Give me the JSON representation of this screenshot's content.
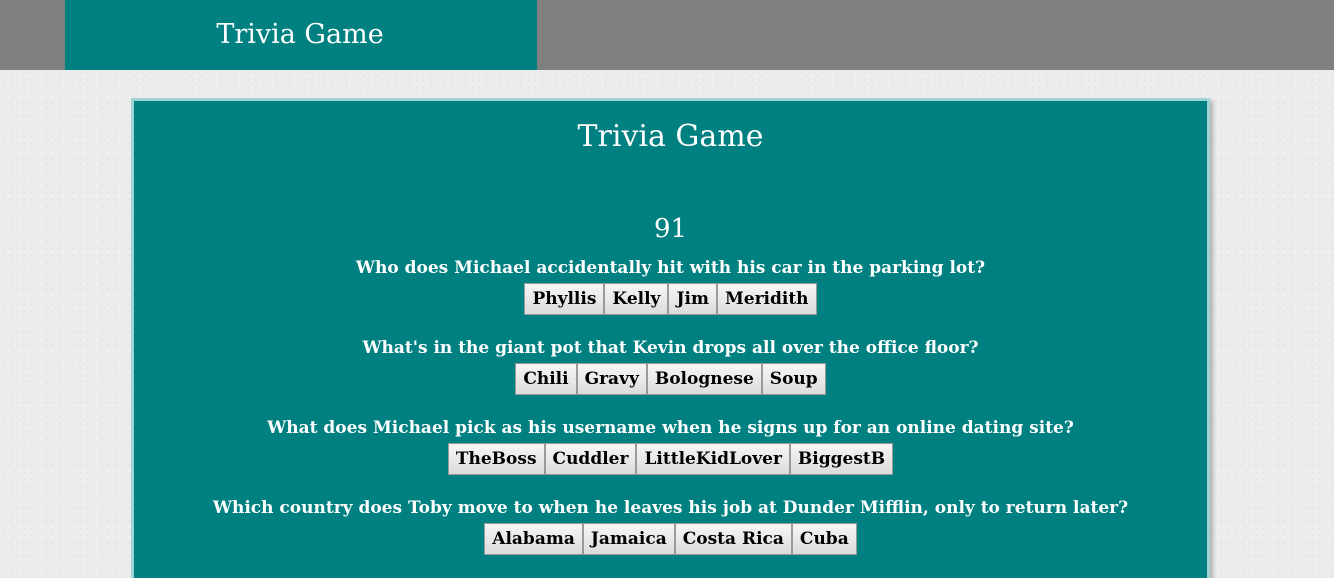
{
  "header": {
    "brand_title": "Trivia Game"
  },
  "card": {
    "title": "Trivia Game",
    "timer": "91"
  },
  "questions": [
    {
      "text": "Who does Michael accidentally hit with his car in the parking lot?",
      "answers": [
        "Phyllis",
        "Kelly",
        "Jim",
        "Meridith"
      ]
    },
    {
      "text": "What's in the giant pot that Kevin drops all over the office floor?",
      "answers": [
        "Chili",
        "Gravy",
        "Bolognese",
        "Soup"
      ]
    },
    {
      "text": "What does Michael pick as his username when he signs up for an online dating site?",
      "answers": [
        "TheBoss",
        "Cuddler",
        "LittleKidLover",
        "BiggestB"
      ]
    },
    {
      "text": "Which country does Toby move to when he leaves his job at Dunder Mifflin, only to return later?",
      "answers": [
        "Alabama",
        "Jamaica",
        "Costa Rica",
        "Cuba"
      ]
    }
  ],
  "colors": {
    "teal": "#008080",
    "gray_bar": "#808080",
    "page_bg": "#ececec"
  }
}
